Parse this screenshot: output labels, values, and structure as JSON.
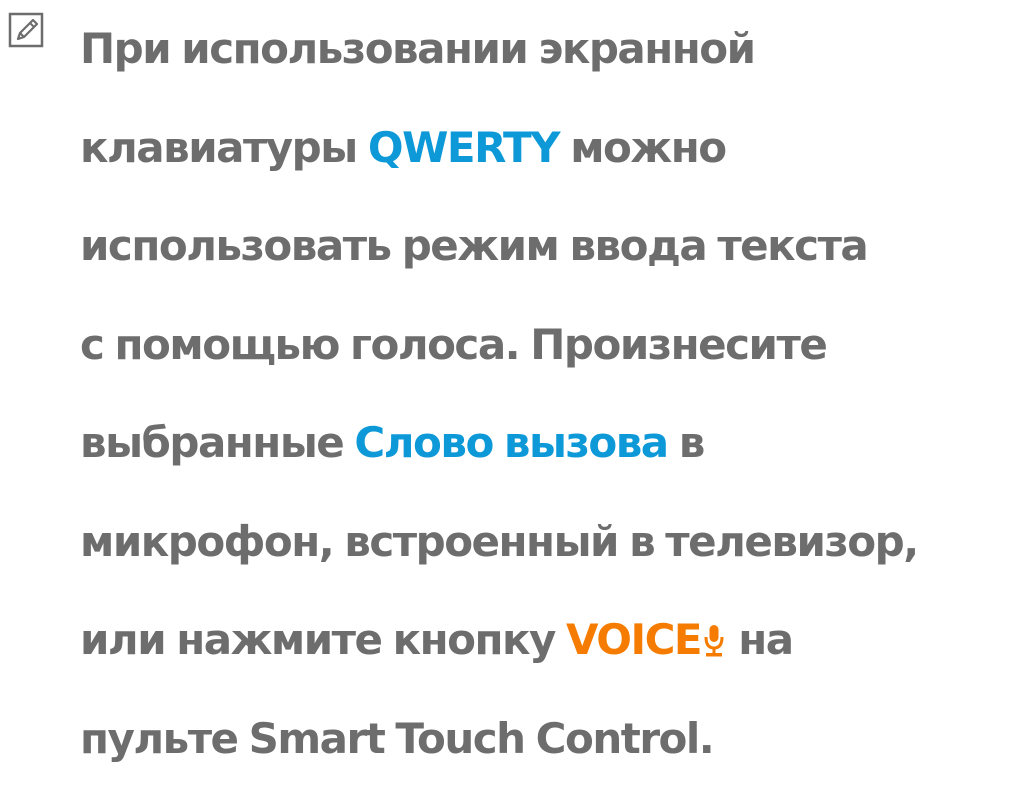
{
  "note": {
    "icon": "note-pencil-icon",
    "lines": [
      {
        "text": "При использовании экранной"
      },
      {
        "before": "клавиатуры ",
        "keyword": "QWERTY",
        "after": " можно"
      },
      {
        "text": "использовать режим ввода текста"
      },
      {
        "text": "с помощью голоса. Произнесите"
      },
      {
        "before": "выбранные ",
        "keyword": "Слово вызова",
        "after": " в"
      },
      {
        "text": "микрофон, встроенный в телевизор,"
      },
      {
        "before": "или нажмите кнопку ",
        "keyword": "VOICE",
        "after": " на"
      },
      {
        "text": "пульте Smart Touch Control."
      }
    ]
  },
  "colors": {
    "text": "#6d6d6d",
    "keyword_blue": "#0d99d8",
    "keyword_orange": "#f57c00"
  },
  "icons": {
    "voice_button": "microphone-icon"
  }
}
